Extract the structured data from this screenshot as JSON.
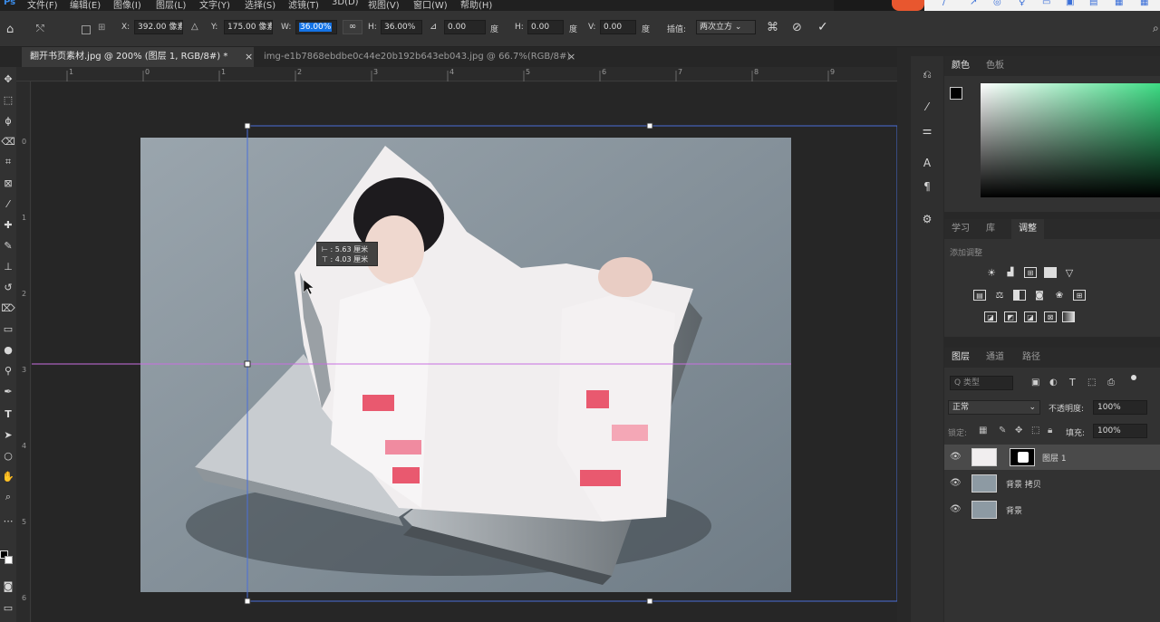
{
  "menu": [
    "文件(F)",
    "编辑(E)",
    "图像(I)",
    "图层(L)",
    "文字(Y)",
    "选择(S)",
    "滤镜(T)",
    "3D(D)",
    "视图(V)",
    "窗口(W)",
    "帮助(H)"
  ],
  "options": {
    "x_label": "X:",
    "x_value": "392.00 像素",
    "y_label": "Y:",
    "y_value": "175.00 像素",
    "w_label": "W:",
    "w_value": "36.00%",
    "h_label": "H:",
    "h_value": "36.00%",
    "angle_value": "0.00",
    "angle_unit": "度",
    "hskew_label": "H:",
    "hskew_value": "0.00",
    "hskew_unit": "度",
    "vskew_label": "V:",
    "vskew_value": "0.00",
    "vskew_unit": "度",
    "interp_label": "插值:",
    "interp_value": "两次立方"
  },
  "tabs": [
    {
      "title": "翻开书页素材.jpg @ 200% (图层 1, RGB/8#) *",
      "close": "×",
      "active": true
    },
    {
      "title": "img-e1b7868ebdbe0c44e20b192b643eb043.jpg @ 66.7%(RGB/8#)",
      "close": "×",
      "active": false
    }
  ],
  "ruler_top": [
    "1",
    "0",
    "1",
    "2",
    "3",
    "4",
    "5",
    "6",
    "7",
    "8",
    "9"
  ],
  "ruler_left": [
    "0",
    "1",
    "2",
    "3",
    "4",
    "5",
    "6"
  ],
  "measure_tooltip": {
    "line1": "⊢ : 5.63 厘米",
    "line2": "⊤ : 4.03 厘米"
  },
  "color_panel": {
    "tabs": [
      "颜色",
      "色板"
    ],
    "gradient_color": "#3ddc84"
  },
  "adjust_panel": {
    "tabs": [
      "学习",
      "库",
      "调整"
    ],
    "title": "添加调整"
  },
  "layers_panel": {
    "tabs": [
      "图层",
      "通道",
      "路径"
    ],
    "filter_placeholder": "Q 类型",
    "blend_mode": "正常",
    "opacity_label": "不透明度:",
    "opacity_value": "100%",
    "lock_label": "锁定:",
    "fill_label": "填充:",
    "fill_value": "100%",
    "layers": [
      {
        "name": "图层 1",
        "selected": true
      },
      {
        "name": "背景 拷贝",
        "selected": false
      },
      {
        "name": "背景",
        "selected": false
      }
    ]
  },
  "colors": {
    "accent": "#1473e6",
    "selection": "#4a6fd8",
    "guide": "#c86ee0"
  }
}
